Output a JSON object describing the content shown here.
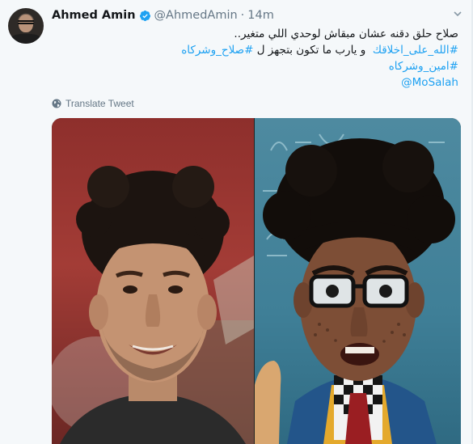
{
  "tweet": {
    "author_name": "Ahmed Amin",
    "handle": "@AhmedAmin",
    "separator": "·",
    "time": "14m",
    "lines": [
      "صلاح حلق دقنه عشان مبقاش لوحدي اللي متغير..",
      "و يارب ما تكون بتجهز ل",
      "#امين_وشركاه"
    ],
    "hashtag_1": "#الله_على_اخلاقك",
    "hashtag_2": "#صلاح_وشركاه",
    "mention": "@MoSalah",
    "translate_label": "Translate Tweet"
  },
  "colors": {
    "link": "#1da1f2",
    "text": "#14171a",
    "muted": "#657786",
    "background": "#f5f8fa"
  },
  "icons": {
    "verified": "verified-badge-icon",
    "translate": "globe-icon",
    "menu": "chevron-down-icon"
  }
}
